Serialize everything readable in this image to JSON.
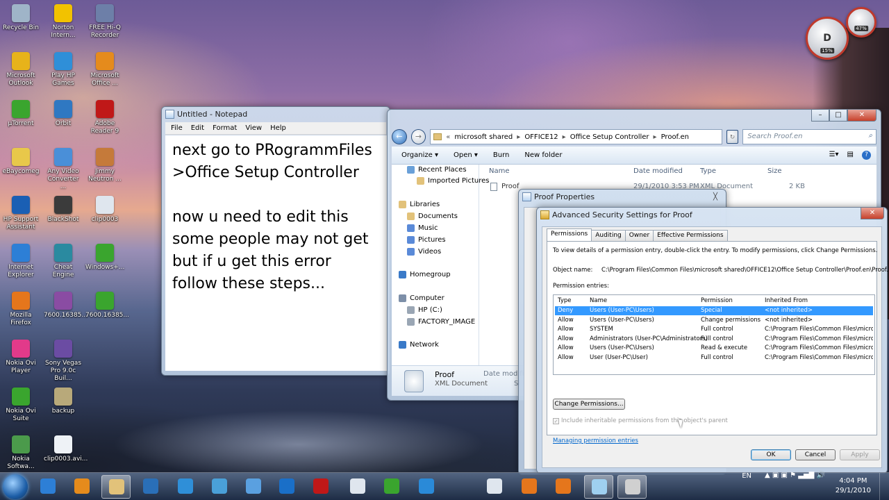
{
  "desktop": {
    "icons": [
      {
        "label": "Recycle Bin",
        "color": "#9fb4c8"
      },
      {
        "label": "Norton Intern...",
        "color": "#f2c200"
      },
      {
        "label": "FREE Hi-Q Recorder",
        "color": "#6d7fa8"
      },
      {
        "label": "Microsoft Outlook",
        "color": "#e7b31a"
      },
      {
        "label": "Play HP Games",
        "color": "#2f8fd8"
      },
      {
        "label": "Microsoft Office ...",
        "color": "#e58b1c"
      },
      {
        "label": "µTorrent",
        "color": "#3aa52e"
      },
      {
        "label": "Orbit",
        "color": "#2f78c2"
      },
      {
        "label": "Adobe Reader 9",
        "color": "#c01818"
      },
      {
        "label": "eBaycomeg",
        "color": "#e8c84a"
      },
      {
        "label": "Any Video Converter ...",
        "color": "#4a8fd8"
      },
      {
        "label": "Jimmy Neutron ...",
        "color": "#c57a3a"
      },
      {
        "label": "HP Support Assistant",
        "color": "#1a5fb4"
      },
      {
        "label": "BlackShot",
        "color": "#3b3b3b"
      },
      {
        "label": "clip0003",
        "color": "#dfe6ee"
      },
      {
        "label": "Internet Explorer",
        "color": "#2d7fd6"
      },
      {
        "label": "Cheat Engine",
        "color": "#2a8aa0"
      },
      {
        "label": "Windows+...",
        "color": "#3aa52e"
      },
      {
        "label": "Mozilla Firefox",
        "color": "#e5761c"
      },
      {
        "label": "7600.16385...",
        "color": "#8a4ca3"
      },
      {
        "label": "7600.16385...",
        "color": "#3aa52e"
      },
      {
        "label": "Nokia Ovi Player",
        "color": "#e23a8a"
      },
      {
        "label": "Sony Vegas Pro 9.0c Buil...",
        "color": "#6b4ca3"
      },
      {
        "label": "Nokia Ovi Suite",
        "color": "#3aa52e"
      },
      {
        "label": "backup",
        "color": "#b8a97a"
      },
      {
        "label": "Nokia Softwa...",
        "color": "#4b9a4b"
      },
      {
        "label": "clip0003.avi...",
        "color": "#eef2f6"
      }
    ]
  },
  "gadget": {
    "primary": "D",
    "cpu": "15%",
    "mem": "47%"
  },
  "notepad": {
    "title": "Untitled - Notepad",
    "menu": [
      "File",
      "Edit",
      "Format",
      "View",
      "Help"
    ],
    "text": "next go to PRogrammFiles\n>Office Setup Controller\n\nnow u need to edit this\nsome people may not get\nbut if u get this error\nfollow these steps..."
  },
  "explorer": {
    "breadcrumb": [
      "«",
      "microsoft shared",
      "OFFICE12",
      "Office Setup Controller",
      "Proof.en"
    ],
    "search_placeholder": "Search Proof.en",
    "toolbar": [
      "Organize ▾",
      "Open ▾",
      "Burn",
      "New folder"
    ],
    "nav": [
      {
        "label": "Recent Places",
        "color": "#6aa0d8"
      },
      {
        "label": "Imported Pictures",
        "color": "#e2c27a"
      },
      {
        "label": "Libraries",
        "color": "#e2c27a"
      },
      {
        "label": "Documents",
        "color": "#e2c27a"
      },
      {
        "label": "Music",
        "color": "#5a8ad8"
      },
      {
        "label": "Pictures",
        "color": "#5a8ad8"
      },
      {
        "label": "Videos",
        "color": "#5a8ad8"
      },
      {
        "label": "Homegroup",
        "color": "#3a7ac8"
      },
      {
        "label": "Computer",
        "color": "#7d8fa8"
      },
      {
        "label": "HP (C:)",
        "color": "#9aa6b4"
      },
      {
        "label": "FACTORY_IMAGE",
        "color": "#9aa6b4"
      },
      {
        "label": "Network",
        "color": "#3a7ac8"
      }
    ],
    "columns": [
      "Name",
      "Date modified",
      "Type",
      "Size"
    ],
    "file": {
      "name": "Proof",
      "date": "29/1/2010 3:53 PM",
      "type": "XML Document",
      "size": "2 KB"
    },
    "details": {
      "name": "Proof",
      "type": "XML Document",
      "date_label": "Date modifi",
      "size_label": "Si"
    }
  },
  "properties": {
    "title": "Proof Properties",
    "close": "╳"
  },
  "advanced": {
    "title": "Advanced Security Settings for Proof",
    "tabs": [
      "Permissions",
      "Auditing",
      "Owner",
      "Effective Permissions"
    ],
    "intro": "To view details of a permission entry, double-click the entry. To modify permissions, click Change Permissions.",
    "object_label": "Object name:",
    "object_name": "C:\\Program Files\\Common Files\\microsoft shared\\OFFICE12\\Office Setup Controller\\Proof.en\\Proof.XML",
    "entries_label": "Permission entries:",
    "columns": [
      "Type",
      "Name",
      "Permission",
      "Inherited From"
    ],
    "rows": [
      {
        "type": "Deny",
        "name": "Users (User-PC\\Users)",
        "permission": "Special",
        "inherited": "<not inherited>"
      },
      {
        "type": "Allow",
        "name": "Users (User-PC\\Users)",
        "permission": "Change permissions",
        "inherited": "<not inherited>"
      },
      {
        "type": "Allow",
        "name": "SYSTEM",
        "permission": "Full control",
        "inherited": "C:\\Program Files\\Common Files\\micro..."
      },
      {
        "type": "Allow",
        "name": "Administrators (User-PC\\Administrators)",
        "permission": "Full control",
        "inherited": "C:\\Program Files\\Common Files\\micro..."
      },
      {
        "type": "Allow",
        "name": "Users (User-PC\\Users)",
        "permission": "Read & execute",
        "inherited": "C:\\Program Files\\Common Files\\micro..."
      },
      {
        "type": "Allow",
        "name": "User (User-PC\\User)",
        "permission": "Full control",
        "inherited": "C:\\Program Files\\Common Files\\micro..."
      }
    ],
    "change_btn": "Change Permissions...",
    "include_label": "Include inheritable permissions from this object's parent",
    "manage_link": "Managing permission entries",
    "ok": "OK",
    "cancel": "Cancel",
    "apply": "Apply"
  },
  "taskbar": {
    "icons": [
      {
        "name": "ie",
        "color": "#2d7fd6"
      },
      {
        "name": "media",
        "color": "#e58b1c"
      },
      {
        "name": "explorer",
        "color": "#e2c27a"
      },
      {
        "name": "app-check",
        "color": "#2a6fb8"
      },
      {
        "name": "download",
        "color": "#2f8fd8"
      },
      {
        "name": "flash",
        "color": "#4aa0d8"
      },
      {
        "name": "people",
        "color": "#5aa0e0"
      },
      {
        "name": "hp",
        "color": "#1a6fc8"
      },
      {
        "name": "red-app",
        "color": "#c01818"
      },
      {
        "name": "doc",
        "color": "#dfe6ee"
      },
      {
        "name": "utorrent",
        "color": "#3aa52e"
      },
      {
        "name": "skype",
        "color": "#2a8ad8"
      },
      {
        "name": "doc2",
        "color": "#dfe6ee"
      },
      {
        "name": "game",
        "color": "#e5761c"
      },
      {
        "name": "firefox",
        "color": "#e5761c"
      },
      {
        "name": "notepad",
        "color": "#9fd0f0"
      },
      {
        "name": "security",
        "color": "#d0d0d0"
      }
    ],
    "lang": "EN",
    "time": "4:04 PM",
    "date": "29/1/2010"
  }
}
